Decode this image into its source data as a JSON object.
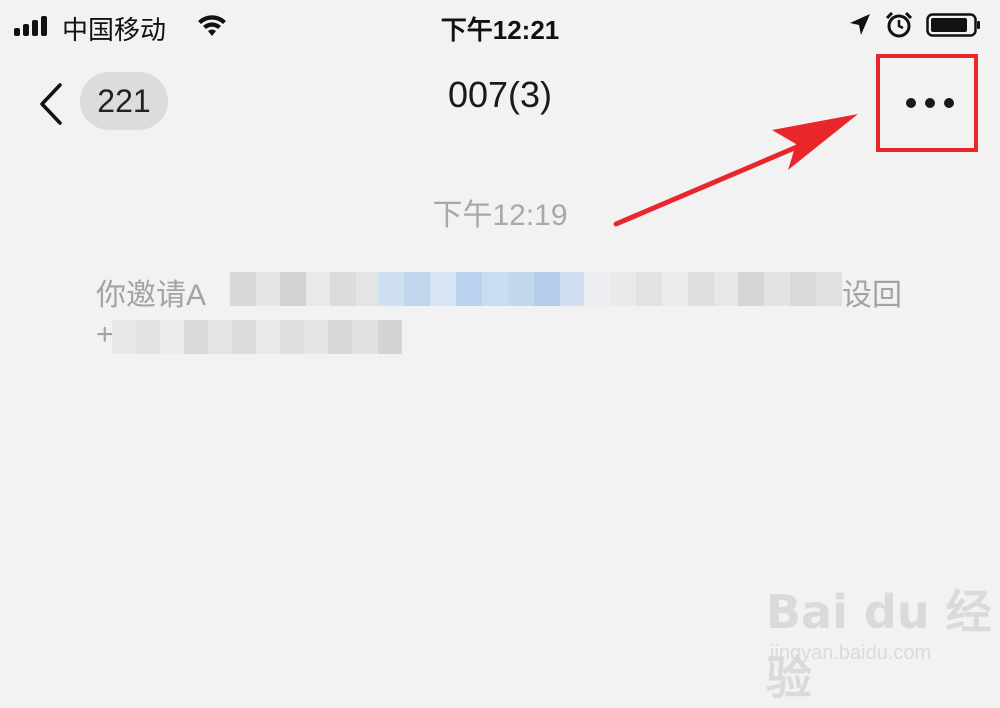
{
  "status_bar": {
    "carrier": "中国移动",
    "time": "下午12:21",
    "icons": [
      "cellular-signal-icon",
      "wifi-icon",
      "location-arrow-icon",
      "alarm-clock-icon",
      "battery-icon"
    ]
  },
  "nav": {
    "back_count": "221",
    "title": "007(3)",
    "more_icon": "more-dots-icon"
  },
  "chat": {
    "timestamp": "下午12:19",
    "system_message": {
      "line1_start": "你邀请A",
      "line1_end": "设回",
      "line2_start": "+"
    }
  },
  "annotation": {
    "highlight_color": "#e8262c"
  },
  "watermark": {
    "logo": "Bai du 经验",
    "url": "jingyan.baidu.com"
  }
}
